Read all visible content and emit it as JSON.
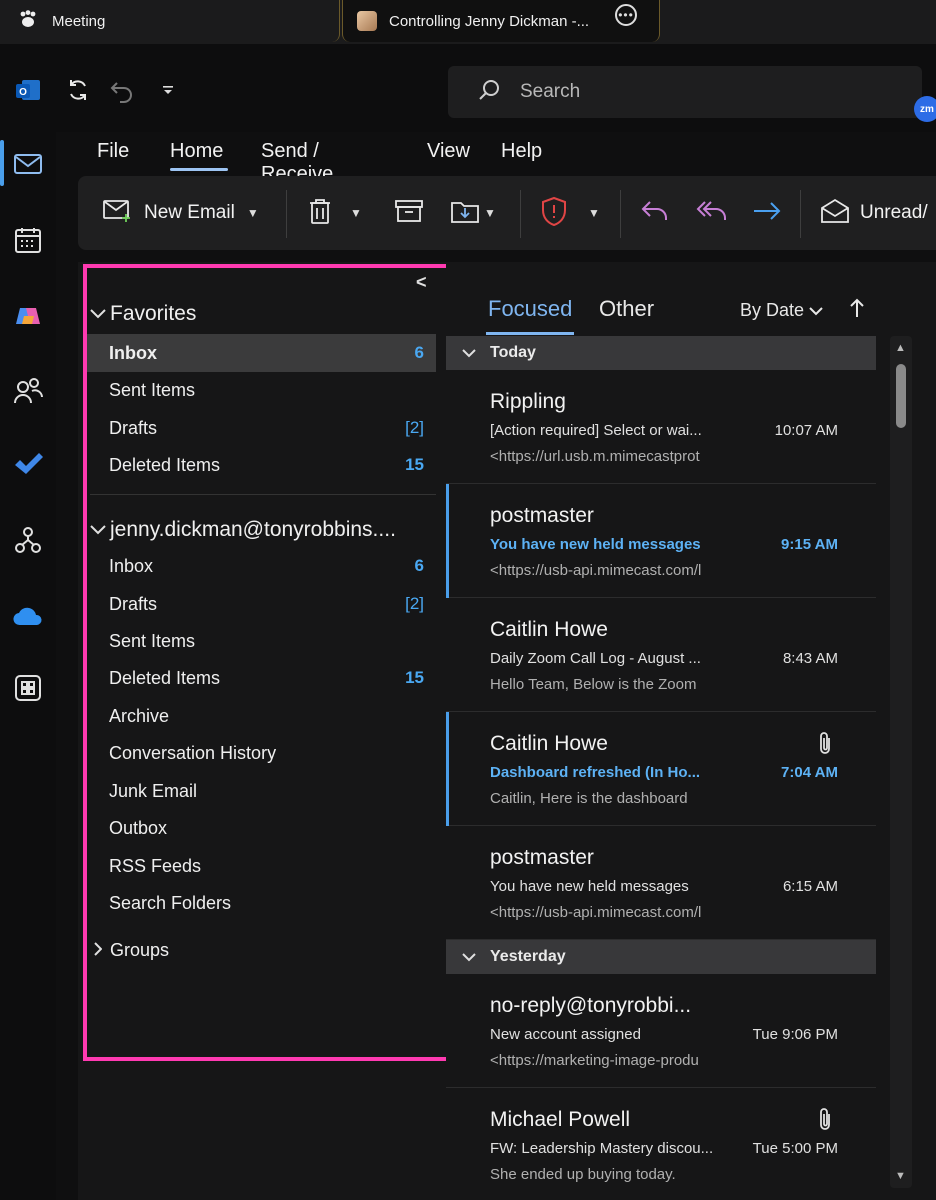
{
  "tabs": {
    "meeting": "Meeting",
    "control": "Controlling Jenny Dickman -..."
  },
  "search": {
    "placeholder": "Search"
  },
  "zoom_badge": "zm",
  "menu": [
    "File",
    "Home",
    "Send / Receive",
    "View",
    "Help"
  ],
  "ribbon": {
    "new_email": "New Email",
    "unread": "Unread/"
  },
  "folders": {
    "favorites_label": "Favorites",
    "favorites": [
      {
        "label": "Inbox",
        "count": "6"
      },
      {
        "label": "Sent Items",
        "count": ""
      },
      {
        "label": "Drafts",
        "count": "[2]"
      },
      {
        "label": "Deleted Items",
        "count": "15"
      }
    ],
    "account_label": "jenny.dickman@tonyrobbins....",
    "account": [
      {
        "label": "Inbox",
        "count": "6"
      },
      {
        "label": "Drafts",
        "count": "[2]"
      },
      {
        "label": "Sent Items",
        "count": ""
      },
      {
        "label": "Deleted Items",
        "count": "15"
      },
      {
        "label": "Archive",
        "count": ""
      },
      {
        "label": "Conversation History",
        "count": ""
      },
      {
        "label": "Junk Email",
        "count": ""
      },
      {
        "label": "Outbox",
        "count": ""
      },
      {
        "label": "RSS Feeds",
        "count": ""
      },
      {
        "label": "Search Folders",
        "count": ""
      }
    ],
    "groups_label": "Groups"
  },
  "list": {
    "focused": "Focused",
    "other": "Other",
    "sort": "By Date",
    "groups": {
      "today": "Today",
      "yesterday": "Yesterday"
    },
    "messages": [
      {
        "sender": "Rippling",
        "subject": "[Action required] Select or wai...",
        "preview": "<https://url.usb.m.mimecastprot",
        "time": "10:07 AM"
      },
      {
        "sender": "postmaster",
        "subject": "You have new held messages",
        "preview": "<https://usb-api.mimecast.com/l",
        "time": "9:15 AM"
      },
      {
        "sender": "Caitlin Howe",
        "subject": "Daily Zoom Call Log - August ...",
        "preview": "Hello Team, Below is the Zoom",
        "time": "8:43 AM"
      },
      {
        "sender": "Caitlin Howe",
        "subject": "Dashboard refreshed (In Ho...",
        "preview": "Caitlin,  Here is the dashboard",
        "time": "7:04 AM"
      },
      {
        "sender": "postmaster",
        "subject": "You have new held messages",
        "preview": "<https://usb-api.mimecast.com/l",
        "time": "6:15 AM"
      },
      {
        "sender": "no-reply@tonyrobbi...",
        "subject": "New account assigned",
        "preview": "<https://marketing-image-produ",
        "time": "Tue 9:06 PM"
      },
      {
        "sender": "Michael Powell",
        "subject": "FW: Leadership Mastery discou...",
        "preview": "She ended up buying today.",
        "time": "Tue 5:00 PM"
      }
    ]
  },
  "colors": {
    "accent": "#4a9eea",
    "highlight_frame": "#ff3ab1"
  }
}
